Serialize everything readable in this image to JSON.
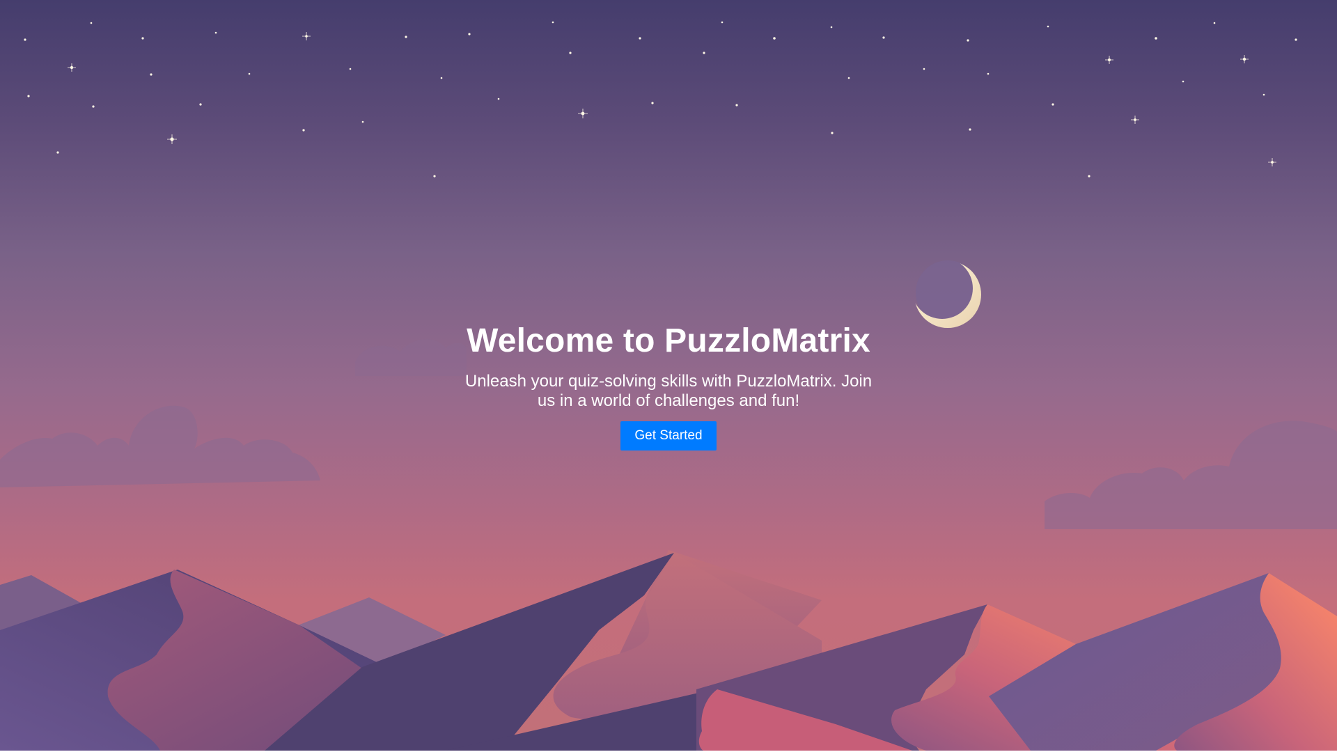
{
  "hero": {
    "title": "Welcome to PuzzloMatrix",
    "subtitle": "Unleash your quiz-solving skills with PuzzloMatrix. Join us in a world of challenges and fun!",
    "cta_label": "Get Started"
  },
  "colors": {
    "cta_background": "#007bff",
    "text": "#ffffff",
    "sky_top": "#453d6d",
    "sky_bottom": "#c46e7c",
    "moon": "#f3e3c3"
  },
  "icons": {
    "moon": "crescent-moon-icon",
    "stars": "star-icon"
  }
}
